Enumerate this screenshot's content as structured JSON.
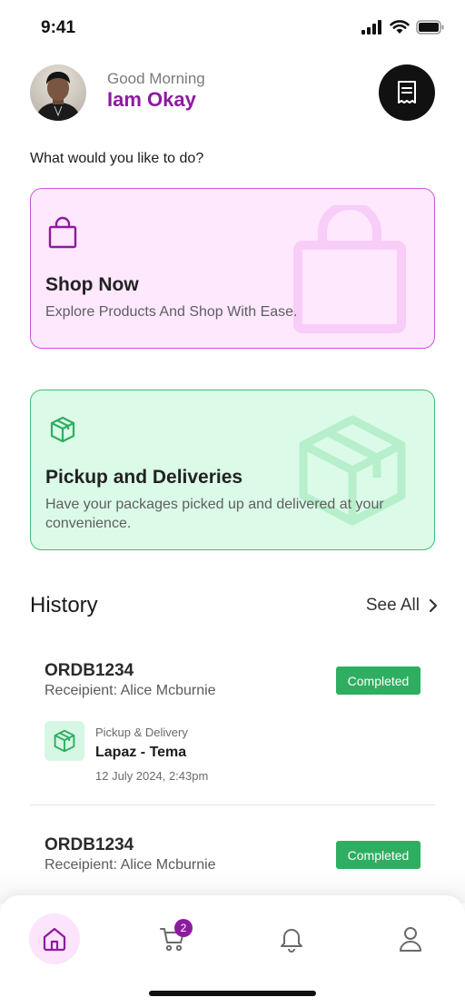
{
  "status_bar": {
    "time": "9:41"
  },
  "header": {
    "greeting": "Good Morning",
    "user_name": "Iam Okay"
  },
  "prompt": "What would you like to do?",
  "cards": {
    "shop": {
      "title": "Shop Now",
      "description": "Explore Products And Shop With Ease."
    },
    "pickup": {
      "title": "Pickup and Deliveries",
      "description": "Have your packages picked up and delivered at your convenience."
    }
  },
  "history": {
    "title": "History",
    "see_all": "See All",
    "orders": [
      {
        "id": "ORDB1234",
        "recipient": "Receipient: Alice Mcburnie",
        "status": "Completed",
        "type": "Pickup & Delivery",
        "route": "Lapaz - Tema",
        "date": "12 July 2024, 2:43pm"
      },
      {
        "id": "ORDB1234",
        "recipient": "Receipient: Alice Mcburnie",
        "status": "Completed"
      }
    ]
  },
  "nav": {
    "cart_count": "2",
    "items": [
      "home-icon",
      "cart-icon",
      "bell-icon",
      "user-icon"
    ]
  },
  "colors": {
    "brand": "#8e1aa0",
    "shop_bg": "#fde8fd",
    "shop_border": "#cf55dc",
    "pickup_bg": "#dbfbe8",
    "pickup_border": "#3fbf6e",
    "status_completed": "#2fae61"
  }
}
